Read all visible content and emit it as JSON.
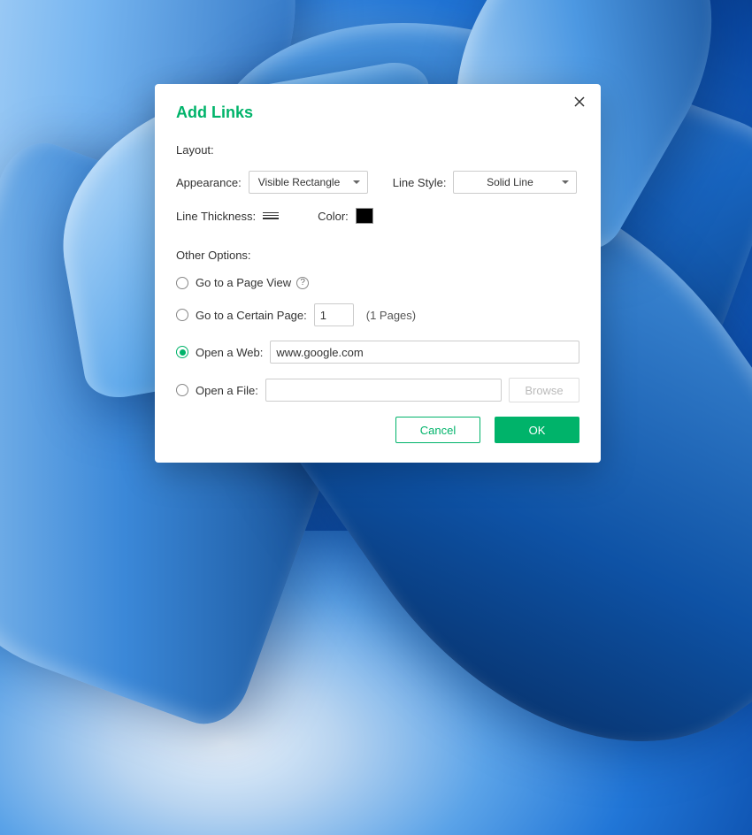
{
  "dialog": {
    "title": "Add Links",
    "layout_label": "Layout:",
    "appearance_label": "Appearance:",
    "appearance_value": "Visible Rectangle",
    "line_style_label": "Line Style:",
    "line_style_value": "Solid Line",
    "line_thickness_label": "Line Thickness:",
    "color_label": "Color:",
    "color_value": "#000000",
    "other_options_label": "Other Options:",
    "options": {
      "page_view": {
        "label": "Go to a Page View",
        "selected": false
      },
      "certain_page": {
        "label": "Go to a Certain Page:",
        "value": "1",
        "pages_note": "(1 Pages)",
        "selected": false
      },
      "open_web": {
        "label": "Open a Web:",
        "value": "www.google.com",
        "selected": true
      },
      "open_file": {
        "label": "Open a File:",
        "value": "",
        "browse_label": "Browse",
        "selected": false
      }
    },
    "buttons": {
      "cancel": "Cancel",
      "ok": "OK"
    }
  }
}
